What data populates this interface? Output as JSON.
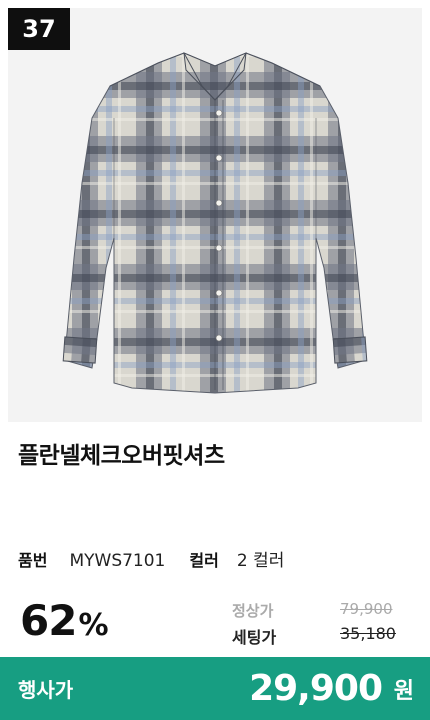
{
  "product": {
    "rank": "37",
    "name": "플란넬체크오버핏셔츠",
    "specs": {
      "code_label": "품번",
      "code_value": "MYWS7101",
      "color_label": "컬러",
      "color_value": "2 컬러"
    },
    "discount": {
      "value": "62",
      "unit": "%"
    },
    "prices": {
      "regular_label": "정상가",
      "regular_value": "79,900",
      "set_label": "세팅가",
      "set_value": "35,180"
    },
    "event": {
      "label": "행사가",
      "price": "29,900",
      "currency": "원"
    }
  },
  "colors": {
    "event_bar": "#179e82",
    "badge": "#0f0f0f",
    "image_bg": "#f3f3f3"
  }
}
